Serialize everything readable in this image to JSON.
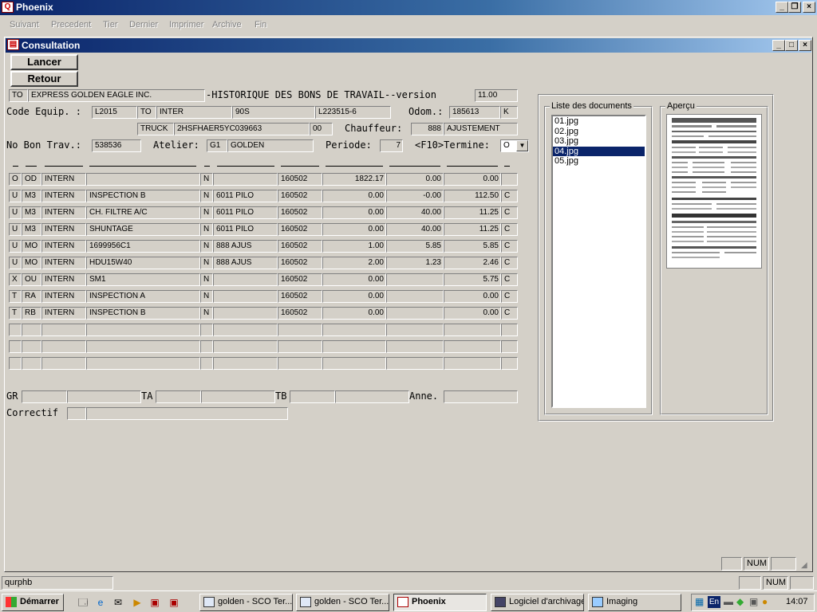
{
  "app": {
    "title": "Phoenix"
  },
  "menu": [
    "Suivant",
    "Precedent",
    "Tier",
    "Dernier",
    "Imprimer",
    "Archive",
    "Fin"
  ],
  "window": {
    "title": "Consultation"
  },
  "buttons": {
    "lancer": "Lancer",
    "retour": "Retour"
  },
  "header": {
    "to_code": "TO",
    "company": "EXPRESS GOLDEN EAGLE INC.",
    "heading": "-HISTORIQUE DES BONS DE TRAVAIL--version",
    "version": "11.00",
    "code_equip_label": "Code Equip. :",
    "code_equip": "L2015",
    "equip_to": "TO",
    "equip_make": "INTER",
    "equip_model": "90S",
    "equip_serial": "L223515-6",
    "odom_label": "Odom.:",
    "odom": "185613",
    "odom_unit": "K",
    "equip_type": "TRUCK",
    "vin": "2HSFHAER5YC039663",
    "vin_extra": "00",
    "chauffeur_label": "Chauffeur:",
    "chauffeur_code": "888",
    "chauffeur_name": "AJUSTEMENT",
    "bon_label": "No Bon Trav.:",
    "bon": "538536",
    "atelier_label": "Atelier:",
    "atelier_code": "G1",
    "atelier_name": "GOLDEN",
    "periode_label": "Periode:",
    "periode": "7",
    "termine_label": "<F10>Termine:",
    "termine": "O"
  },
  "rows": [
    {
      "c1": "O",
      "c2": "OD",
      "c3": "INTERN",
      "c4": "",
      "c5": "N",
      "c6": "",
      "c7": "160502",
      "c8": "1822.17",
      "c9": "0.00",
      "c10": "0.00",
      "c11": ""
    },
    {
      "c1": "U",
      "c2": "M3",
      "c3": "INTERN",
      "c4": "INSPECTION B",
      "c5": "N",
      "c6": "6011 PILO",
      "c7": "160502",
      "c8": "0.00",
      "c9": "-0.00",
      "c10": "112.50",
      "c11": "C"
    },
    {
      "c1": "U",
      "c2": "M3",
      "c3": "INTERN",
      "c4": "CH. FILTRE A/C",
      "c5": "N",
      "c6": "6011 PILO",
      "c7": "160502",
      "c8": "0.00",
      "c9": "40.00",
      "c10": "11.25",
      "c11": "C"
    },
    {
      "c1": "U",
      "c2": "M3",
      "c3": "INTERN",
      "c4": "SHUNTAGE",
      "c5": "N",
      "c6": "6011 PILO",
      "c7": "160502",
      "c8": "0.00",
      "c9": "40.00",
      "c10": "11.25",
      "c11": "C"
    },
    {
      "c1": "U",
      "c2": "MO",
      "c3": "INTERN",
      "c4": "1699956C1",
      "c5": "N",
      "c6": "888 AJUS",
      "c7": "160502",
      "c8": "1.00",
      "c9": "5.85",
      "c10": "5.85",
      "c11": "C"
    },
    {
      "c1": "U",
      "c2": "MO",
      "c3": "INTERN",
      "c4": "HDU15W40",
      "c5": "N",
      "c6": "888 AJUS",
      "c7": "160502",
      "c8": "2.00",
      "c9": "1.23",
      "c10": "2.46",
      "c11": "C"
    },
    {
      "c1": "X",
      "c2": "OU",
      "c3": "INTERN",
      "c4": "SM1",
      "c5": "N",
      "c6": "",
      "c7": "160502",
      "c8": "0.00",
      "c9": "",
      "c10": "5.75",
      "c11": "C"
    },
    {
      "c1": "T",
      "c2": "RA",
      "c3": "INTERN",
      "c4": "INSPECTION A",
      "c5": "N",
      "c6": "",
      "c7": "160502",
      "c8": "0.00",
      "c9": "",
      "c10": "0.00",
      "c11": "C"
    },
    {
      "c1": "T",
      "c2": "RB",
      "c3": "INTERN",
      "c4": "INSPECTION B",
      "c5": "N",
      "c6": "",
      "c7": "160502",
      "c8": "0.00",
      "c9": "",
      "c10": "0.00",
      "c11": "C"
    },
    {
      "c1": "",
      "c2": "",
      "c3": "",
      "c4": "",
      "c5": "",
      "c6": "",
      "c7": "",
      "c8": "",
      "c9": "",
      "c10": "",
      "c11": ""
    },
    {
      "c1": "",
      "c2": "",
      "c3": "",
      "c4": "",
      "c5": "",
      "c6": "",
      "c7": "",
      "c8": "",
      "c9": "",
      "c10": "",
      "c11": ""
    },
    {
      "c1": "",
      "c2": "",
      "c3": "",
      "c4": "",
      "c5": "",
      "c6": "",
      "c7": "",
      "c8": "",
      "c9": "",
      "c10": "",
      "c11": ""
    }
  ],
  "footer": {
    "gr_label": "GR",
    "ta_label": "TA",
    "tb_label": "TB",
    "anne_label": "Anne.",
    "correctif_label": "Correctif"
  },
  "documents": {
    "group_title": "Liste des documents",
    "items": [
      "01.jpg",
      "02.jpg",
      "03.jpg",
      "04.jpg",
      "05.jpg"
    ],
    "selected": "04.jpg",
    "preview_title": "Aperçu"
  },
  "child_status": {
    "num": "NUM"
  },
  "status": {
    "user": "qurphb",
    "num": "NUM"
  },
  "taskbar": {
    "start": "Démarrer",
    "tasks": [
      "golden - SCO Ter...",
      "golden - SCO Ter...",
      "Phoenix",
      "Logiciel d'archivage",
      "Imaging"
    ],
    "active": "Phoenix",
    "clock": "14:07",
    "lang": "En"
  },
  "colors": {
    "title_active": "#0a246a",
    "face": "#d4d0c8",
    "selection": "#0a246a"
  }
}
